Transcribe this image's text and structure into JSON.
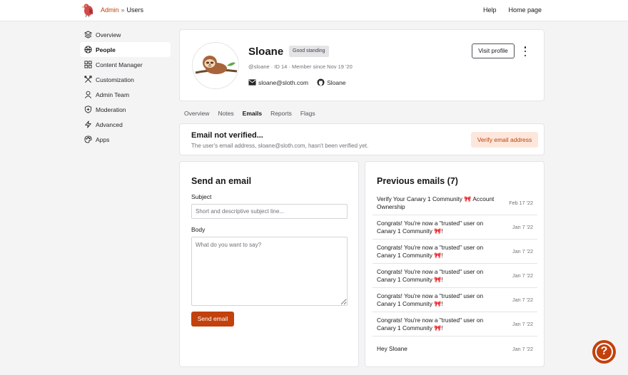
{
  "header": {
    "breadcrumb_root": "Admin",
    "breadcrumb_sep": "»",
    "breadcrumb_current": "Users",
    "links": [
      "Help",
      "Home page"
    ]
  },
  "sidebar": {
    "items": [
      {
        "label": "Overview",
        "icon": "layers-icon"
      },
      {
        "label": "People",
        "icon": "globe-icon"
      },
      {
        "label": "Content Manager",
        "icon": "grid-icon"
      },
      {
        "label": "Customization",
        "icon": "tools-icon"
      },
      {
        "label": "Admin Team",
        "icon": "user-icon"
      },
      {
        "label": "Moderation",
        "icon": "shield-icon"
      },
      {
        "label": "Advanced",
        "icon": "bolt-icon"
      },
      {
        "label": "Apps",
        "icon": "palette-icon"
      }
    ],
    "active": "People"
  },
  "profile": {
    "name": "Sloane",
    "badge": "Good standing",
    "meta": "@sloane · ID 14 · Member since Nov 19 '20",
    "email": "sloane@sloth.com",
    "github": "Sloane",
    "visit_label": "Visit profile"
  },
  "tabs": [
    "Overview",
    "Notes",
    "Emails",
    "Reports",
    "Flags"
  ],
  "active_tab": "Emails",
  "verify": {
    "title": "Email not verified...",
    "desc": "The user's email address, sloane@sloth.com, hasn't been verified yet.",
    "button": "Verify email address"
  },
  "send": {
    "title": "Send an email",
    "subject_label": "Subject",
    "subject_placeholder": "Short and descriptive subject line...",
    "body_label": "Body",
    "body_placeholder": "What do you want to say?",
    "button": "Send email"
  },
  "previous": {
    "title": "Previous emails (7)",
    "emails": [
      {
        "subject": "Verify Your Canary 1 Community 🎀 Account Ownership",
        "date": "Feb 17 '22"
      },
      {
        "subject": "Congrats! You're now a \"trusted\" user on Canary 1 Community 🎀!",
        "date": "Jan 7 '22"
      },
      {
        "subject": "Congrats! You're now a \"trusted\" user on Canary 1 Community 🎀!",
        "date": "Jan 7 '22"
      },
      {
        "subject": "Congrats! You're now a \"trusted\" user on Canary 1 Community 🎀!",
        "date": "Jan 7 '22"
      },
      {
        "subject": "Congrats! You're now a \"trusted\" user on Canary 1 Community 🎀!",
        "date": "Jan 7 '22"
      },
      {
        "subject": "Congrats! You're now a \"trusted\" user on Canary 1 Community 🎀!",
        "date": "Jan 7 '22"
      },
      {
        "subject": "Hey Sloane",
        "date": "Jan 7 '22"
      }
    ]
  },
  "colors": {
    "accent": "#c2410c",
    "accent_soft": "#fde7dc",
    "background": "#f4f4f5"
  }
}
